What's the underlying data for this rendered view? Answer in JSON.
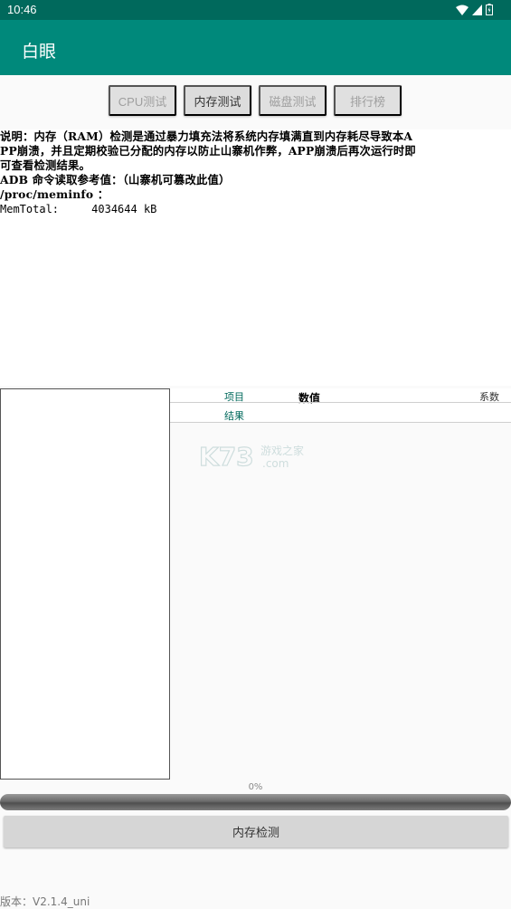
{
  "status_bar": {
    "time": "10:46"
  },
  "app_bar": {
    "title": "白眼"
  },
  "tabs": [
    {
      "label": "CPU测试",
      "active": false
    },
    {
      "label": "内存测试",
      "active": true
    },
    {
      "label": "磁盘测试",
      "active": false
    },
    {
      "label": "排行榜",
      "active": false
    }
  ],
  "description": {
    "lines": [
      "说明：内存（RAM）检测是通过暴力填充法将系统内存填满直到内存耗尽导致本A",
      "PP崩溃，并且定期校验已分配的内存以防止山寨机作弊，APP崩溃后再次运行时即",
      "可查看检测结果。",
      "ADB 命令读取参考值：（山寨机可篡改此值）",
      "/proc/meminfo ："
    ],
    "mem_total": "MemTotal:     4034644 kB"
  },
  "table": {
    "col_item": "项目",
    "col_value": "数值",
    "col_coef": "系数",
    "row_result": "结果"
  },
  "watermark": {
    "brand": "K73",
    "site_cn": "游戏之家",
    "site_en": ".com"
  },
  "progress": {
    "label": "0%",
    "value": 0
  },
  "run_button": {
    "label": "内存检测"
  },
  "version": "版本：V2.1.4_uni",
  "colors": {
    "status_bar": "#00695c",
    "app_bar": "#00897b",
    "accent_text": "#00695c"
  }
}
